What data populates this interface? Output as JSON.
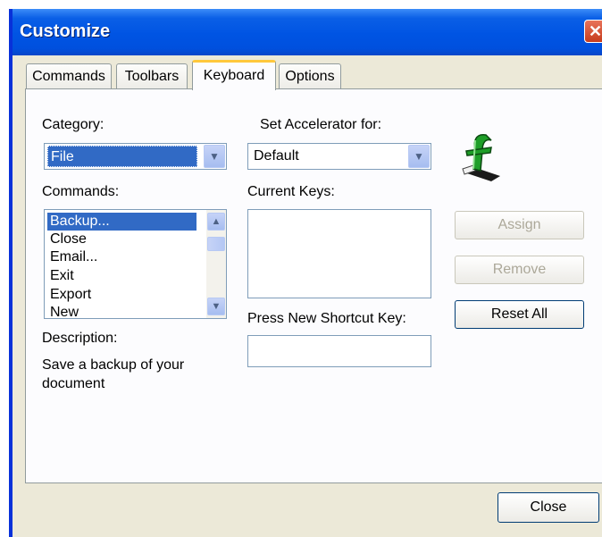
{
  "window": {
    "title": "Customize",
    "close_glyph": "✕"
  },
  "tabs": [
    {
      "label": "Commands"
    },
    {
      "label": "Toolbars"
    },
    {
      "label": "Keyboard",
      "active": true
    },
    {
      "label": "Options"
    }
  ],
  "category": {
    "label": "Category:",
    "value": "File"
  },
  "accelerator": {
    "label": "Set Accelerator for:",
    "value": "Default"
  },
  "commands": {
    "label": "Commands:",
    "items": [
      "Backup...",
      "Close",
      "Email...",
      "Exit",
      "Export",
      "New"
    ],
    "selected": "Backup..."
  },
  "current_keys": {
    "label": "Current Keys:"
  },
  "shortcut": {
    "label": "Press New Shortcut Key:",
    "value": ""
  },
  "description": {
    "label": "Description:",
    "text": "Save a backup of your document"
  },
  "buttons": {
    "assign": "Assign",
    "remove": "Remove",
    "reset_all": "Reset All",
    "close": "Close"
  },
  "icons": {
    "app_logo": "finale-f-logo-icon",
    "dropdown": "chevron-down-icon",
    "scroll_up": "scroll-up-icon",
    "scroll_down": "scroll-down-icon"
  }
}
